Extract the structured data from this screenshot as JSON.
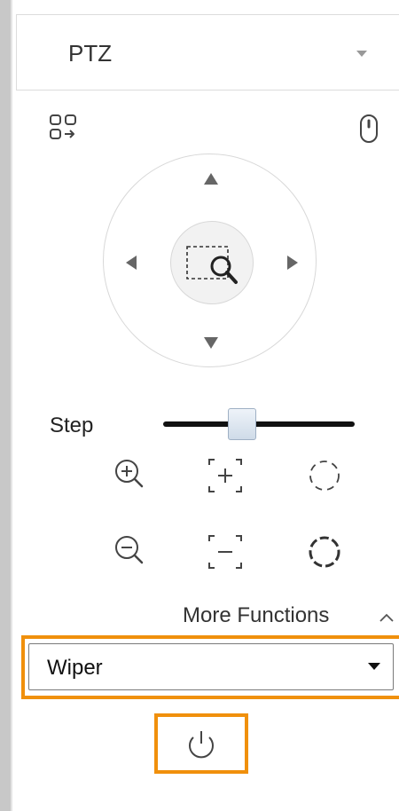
{
  "header": {
    "title": "PTZ"
  },
  "toolbar": {
    "layout_icon": "layout-switch-icon",
    "mouse_icon": "mouse-icon"
  },
  "ptz": {
    "up_icon": "arrow-up-icon",
    "down_icon": "arrow-down-icon",
    "left_icon": "arrow-left-icon",
    "right_icon": "arrow-right-icon",
    "center_icon": "area-zoom-icon"
  },
  "step": {
    "label": "Step",
    "value_fraction": 0.41
  },
  "lens_controls": [
    {
      "icon": "zoom-in-icon"
    },
    {
      "icon": "focus-near-icon"
    },
    {
      "icon": "iris-open-icon"
    },
    {
      "icon": "zoom-out-icon"
    },
    {
      "icon": "focus-far-icon"
    },
    {
      "icon": "iris-close-icon"
    }
  ],
  "more_functions": {
    "label": "More Functions",
    "expanded": true
  },
  "function_select": {
    "value": "Wiper"
  },
  "power": {
    "icon": "power-icon"
  },
  "colors": {
    "highlight": "#f0900c",
    "icon": "#444444",
    "ring_border": "#d8d8d8"
  }
}
